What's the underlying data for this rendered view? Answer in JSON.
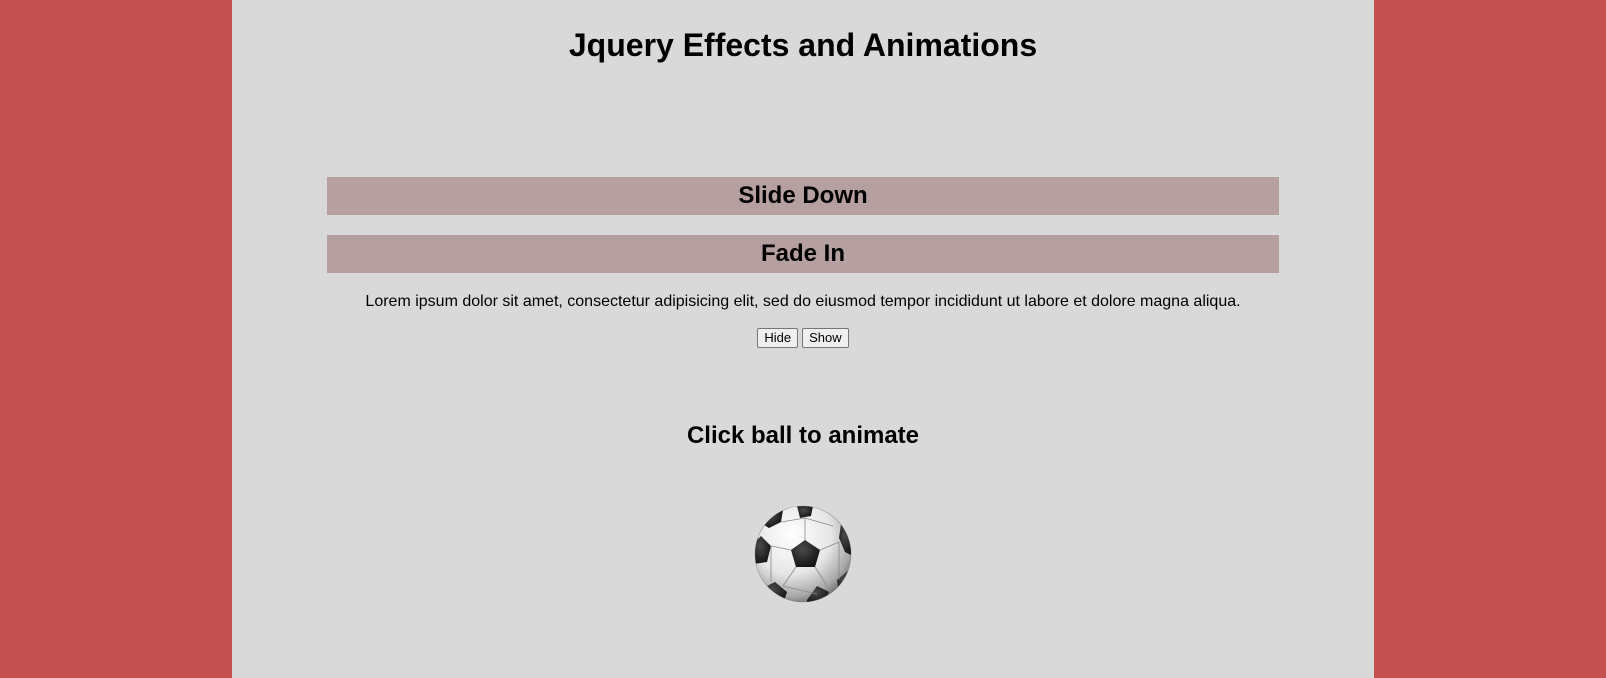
{
  "page": {
    "title": "Jquery Effects and Animations",
    "background_color": "#c45050",
    "content_background_color": "#d9d9d9"
  },
  "effects": {
    "bar_color": "#b59f9f",
    "slide_down_label": "Slide Down",
    "fade_in_label": "Fade In"
  },
  "toggle_section": {
    "paragraph": "Lorem ipsum dolor sit amet, consectetur adipisicing elit, sed do eiusmod tempor incididunt ut labore et dolore magna aliqua.",
    "hide_label": "Hide",
    "show_label": "Show"
  },
  "animation_section": {
    "heading": "Click ball to animate",
    "ball_icon": "soccer-ball-icon"
  }
}
